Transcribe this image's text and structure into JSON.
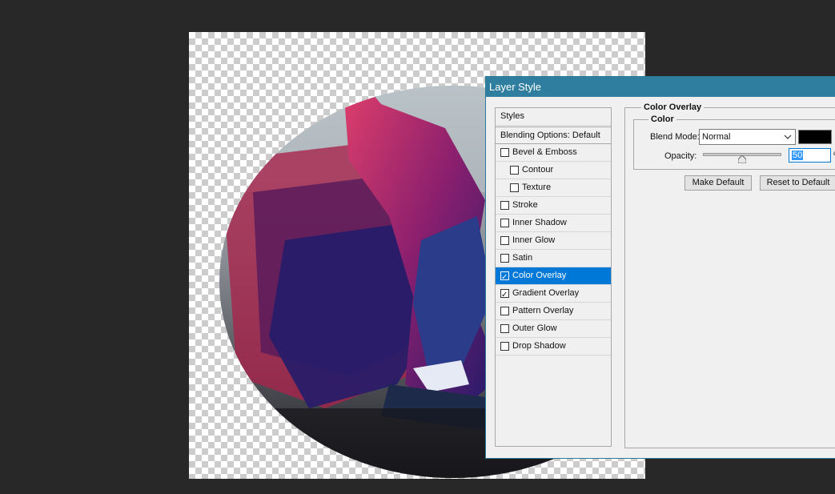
{
  "dialog": {
    "title": "Layer Style"
  },
  "styles_list": {
    "header": "Styles",
    "blending": "Blending Options: Default",
    "items": [
      {
        "label": "Bevel & Emboss",
        "checked": false,
        "indent": false,
        "selected": false
      },
      {
        "label": "Contour",
        "checked": false,
        "indent": true,
        "selected": false
      },
      {
        "label": "Texture",
        "checked": false,
        "indent": true,
        "selected": false
      },
      {
        "label": "Stroke",
        "checked": false,
        "indent": false,
        "selected": false
      },
      {
        "label": "Inner Shadow",
        "checked": false,
        "indent": false,
        "selected": false
      },
      {
        "label": "Inner Glow",
        "checked": false,
        "indent": false,
        "selected": false
      },
      {
        "label": "Satin",
        "checked": false,
        "indent": false,
        "selected": false
      },
      {
        "label": "Color Overlay",
        "checked": true,
        "indent": false,
        "selected": true
      },
      {
        "label": "Gradient Overlay",
        "checked": true,
        "indent": false,
        "selected": false
      },
      {
        "label": "Pattern Overlay",
        "checked": false,
        "indent": false,
        "selected": false
      },
      {
        "label": "Outer Glow",
        "checked": false,
        "indent": false,
        "selected": false
      },
      {
        "label": "Drop Shadow",
        "checked": false,
        "indent": false,
        "selected": false
      }
    ]
  },
  "color_overlay": {
    "section_title": "Color Overlay",
    "group_title": "Color",
    "blend_mode_label": "Blend Mode:",
    "blend_mode_value": "Normal",
    "overlay_color": "#000000",
    "opacity_label": "Opacity:",
    "opacity_value": "50",
    "opacity_unit": "%",
    "opacity_fraction": 0.5,
    "make_default_label": "Make Default",
    "reset_default_label": "Reset to Default"
  },
  "colors": {
    "titlebar": "#2f7e9f",
    "selection": "#0078d7"
  }
}
